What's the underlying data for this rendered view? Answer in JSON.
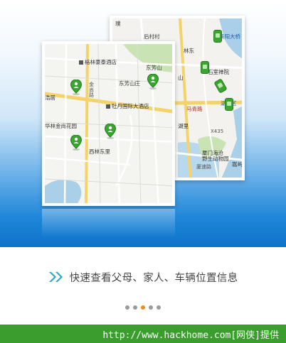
{
  "back_map": {
    "labels": {
      "top_left": "璞",
      "village": "后村村",
      "bridge": "集阳大桥",
      "lin": "林东",
      "temple": "石室禅院",
      "mid_left": "山",
      "district": "湖里区",
      "road": "马青路",
      "area": "湖里",
      "hwy": "X435",
      "zoo": "厦门海沧\n野生动物园",
      "expressway": "厦速路",
      "shore": "嵩屿"
    }
  },
  "front_map": {
    "labels": {
      "hotel1": "格林豪泰酒店",
      "mountain": "东芳山",
      "resort": "东芳山庄",
      "road_vertical": "金尚路",
      "hotel2": "牡丹国际大酒店",
      "west": "浩居",
      "garden": "华林金尚花园",
      "east_village": "西林东里"
    }
  },
  "caption": {
    "icon": "double-chevron-right-icon",
    "text": "快速查看父母、家人、车辆位置信息"
  },
  "pager": {
    "count": 5,
    "active_index": 2
  },
  "footer": {
    "text": "http://www.hackhome.com[网侠]提供"
  },
  "colors": {
    "accent_blue": "#1f86d8",
    "pin_green": "#3aa631",
    "footer_green": "#3a9d2e",
    "active_dot": "#ef8b1c",
    "chevron": "#2aa7c9"
  }
}
